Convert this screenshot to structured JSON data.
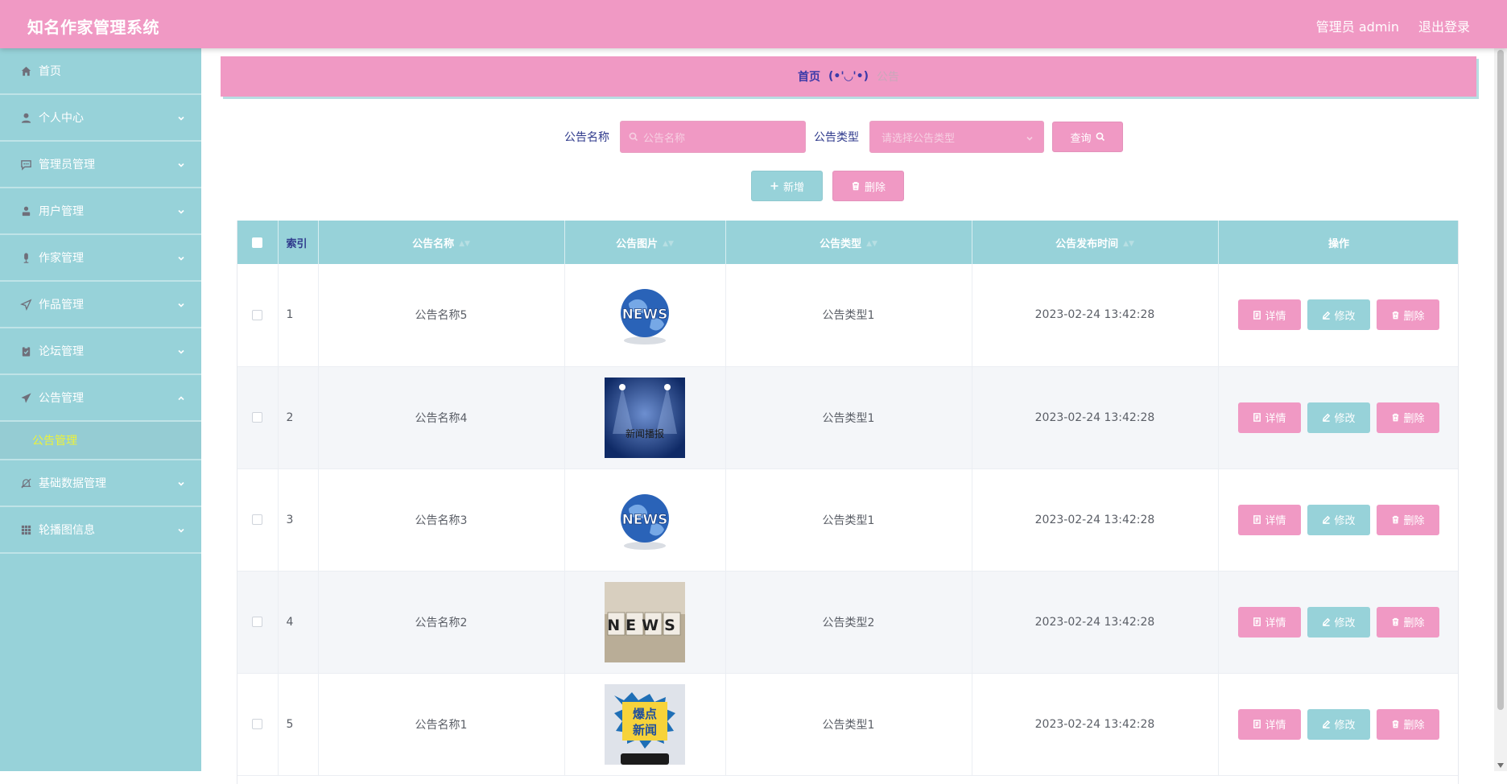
{
  "header": {
    "title": "知名作家管理系统",
    "admin_label": "管理员 admin",
    "logout_label": "退出登录"
  },
  "sidebar": {
    "items": [
      {
        "label": "首页",
        "icon": "home-icon"
      },
      {
        "label": "个人中心",
        "icon": "user-icon"
      },
      {
        "label": "管理员管理",
        "icon": "chat-icon"
      },
      {
        "label": "用户管理",
        "icon": "person-icon"
      },
      {
        "label": "作家管理",
        "icon": "microphone-icon"
      },
      {
        "label": "作品管理",
        "icon": "send-icon"
      },
      {
        "label": "论坛管理",
        "icon": "clipboard-icon"
      },
      {
        "label": "公告管理",
        "icon": "paper-plane-icon"
      },
      {
        "label": "基础数据管理",
        "icon": "bell-off-icon"
      },
      {
        "label": "轮播图信息",
        "icon": "grid-icon"
      }
    ],
    "active_sub": "公告管理"
  },
  "breadcrumb": {
    "home": "首页",
    "sep": "(•'◡'•)",
    "current": "公告"
  },
  "search": {
    "name_label": "公告名称",
    "name_placeholder": "公告名称",
    "type_label": "公告类型",
    "type_placeholder": "请选择公告类型",
    "query_label": "查询"
  },
  "actions": {
    "add_label": "新增",
    "delete_label": "删除"
  },
  "table": {
    "columns": [
      "索引",
      "公告名称",
      "公告图片",
      "公告类型",
      "公告发布时间",
      "操作"
    ],
    "rows": [
      {
        "index": "1",
        "name": "公告名称5",
        "image": "globe-news",
        "type": "公告类型1",
        "time": "2023-02-24 13:42:28"
      },
      {
        "index": "2",
        "name": "公告名称4",
        "image": "stage-news",
        "type": "公告类型1",
        "time": "2023-02-24 13:42:28"
      },
      {
        "index": "3",
        "name": "公告名称3",
        "image": "globe-news",
        "type": "公告类型1",
        "time": "2023-02-24 13:42:28"
      },
      {
        "index": "4",
        "name": "公告名称2",
        "image": "blocks-news",
        "type": "公告类型2",
        "time": "2023-02-24 13:42:28"
      },
      {
        "index": "5",
        "name": "公告名称1",
        "image": "breaking-news",
        "type": "公告类型1",
        "time": "2023-02-24 13:42:28"
      }
    ],
    "row_actions": {
      "detail": "详情",
      "edit": "修改",
      "delete": "删除"
    },
    "image_texts": {
      "stage": "新闻播报",
      "blocks": "NEWS",
      "breaking_1": "爆点",
      "breaking_2": "新闻",
      "globe": "NEWS"
    }
  },
  "colors": {
    "header": "#f099c4",
    "sidebar": "#97d2d9",
    "active_sub_text": "#ecf23a",
    "label_text": "#2f3a8c"
  }
}
